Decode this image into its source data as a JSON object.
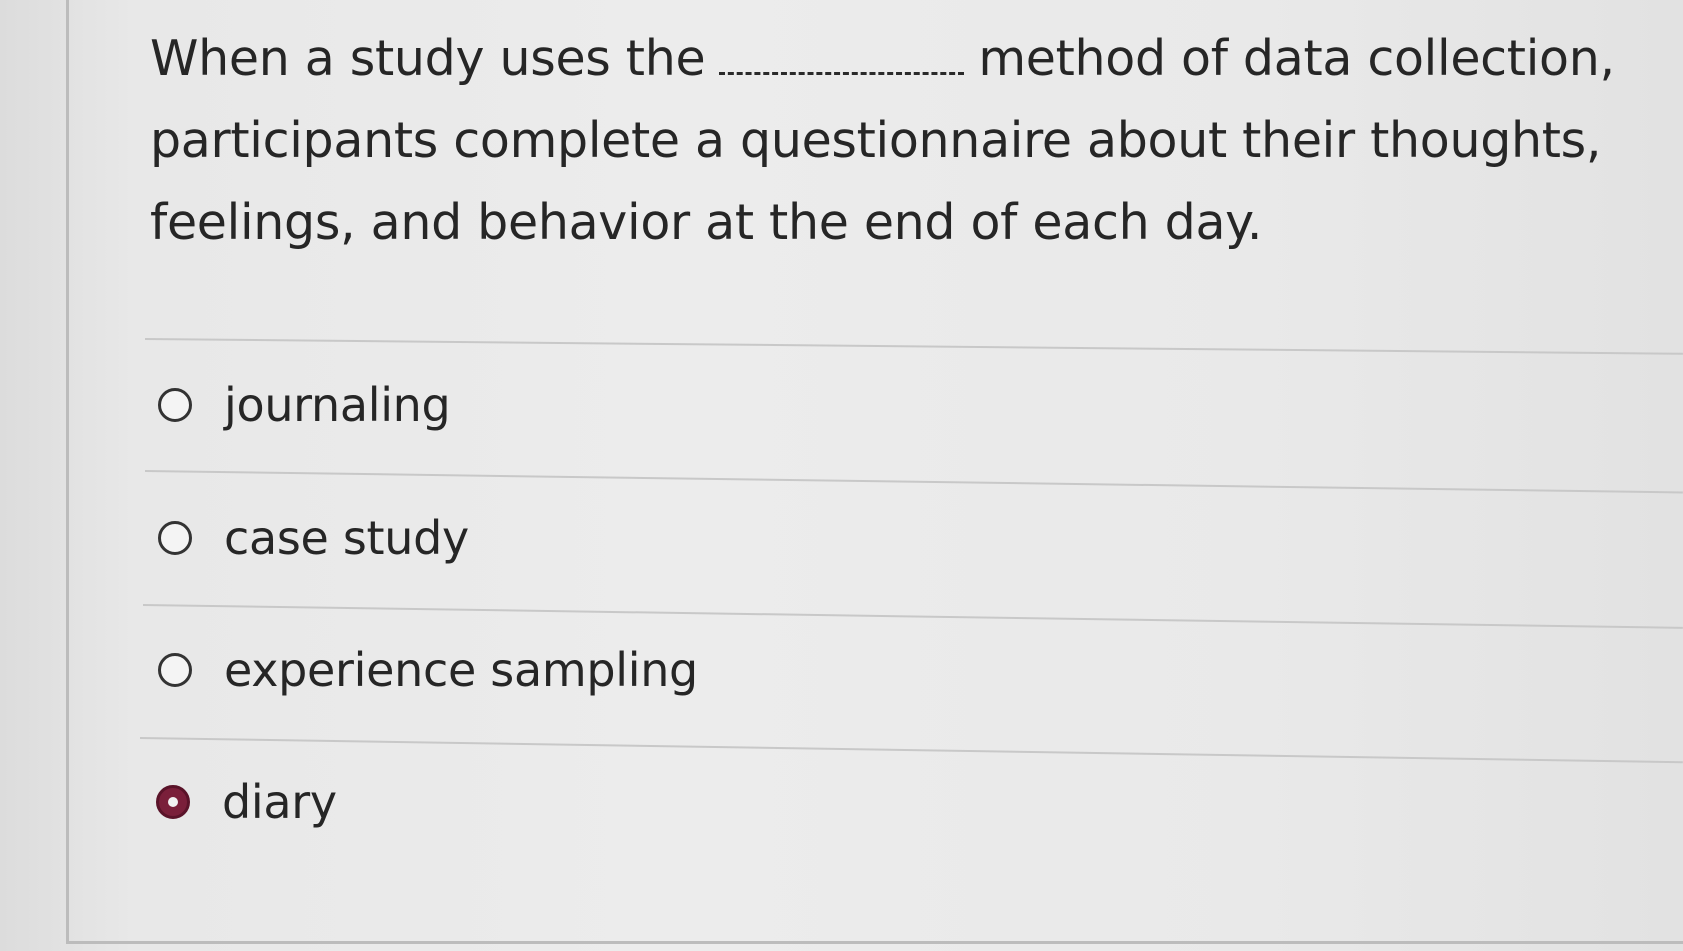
{
  "question": {
    "part1": "When a study uses the",
    "part2": "method of data collection, participants complete a questionnaire about their thoughts, feelings, and behavior at the end of each day."
  },
  "options": [
    {
      "label": "journaling",
      "selected": false
    },
    {
      "label": "case study",
      "selected": false
    },
    {
      "label": "experience sampling",
      "selected": false
    },
    {
      "label": "diary",
      "selected": true
    }
  ],
  "colors": {
    "selected_radio": "#7a1f3a"
  }
}
